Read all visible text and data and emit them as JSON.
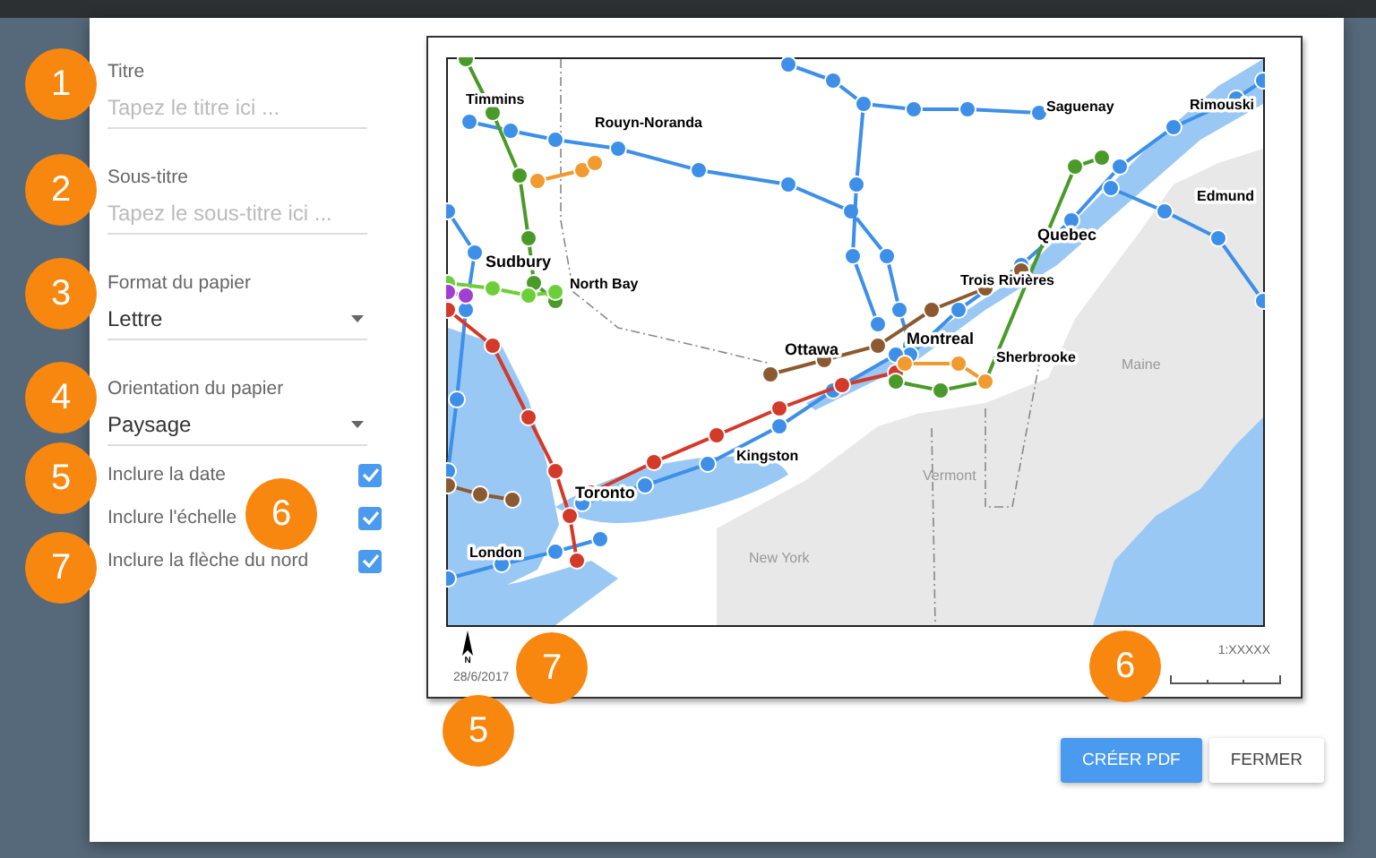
{
  "form": {
    "fields": [
      {
        "kind": "text",
        "label": "Titre",
        "placeholder": "Tapez le titre ici ..."
      },
      {
        "kind": "text",
        "label": "Sous-titre",
        "placeholder": "Tapez le sous-titre ici ..."
      },
      {
        "kind": "select",
        "label": "Format du papier",
        "value": "Lettre"
      },
      {
        "kind": "select",
        "label": "Orientation du papier",
        "value": "Paysage"
      }
    ],
    "options": [
      {
        "label": "Inclure la date",
        "checked": true
      },
      {
        "label": "Inclure l'échelle",
        "checked": true
      },
      {
        "label": "Inclure la flèche du nord",
        "checked": true
      }
    ]
  },
  "preview": {
    "map_labels": [
      {
        "text": "Timmins",
        "kind": "city"
      },
      {
        "text": "Rouyn-Noranda",
        "kind": "city"
      },
      {
        "text": "Saguenay",
        "kind": "city"
      },
      {
        "text": "Rimouski",
        "kind": "city"
      },
      {
        "text": "Edmund",
        "kind": "city"
      },
      {
        "text": "Quebec",
        "kind": "major"
      },
      {
        "text": "Sudbury",
        "kind": "major"
      },
      {
        "text": "North Bay",
        "kind": "city"
      },
      {
        "text": "Trois Rivières",
        "kind": "city"
      },
      {
        "text": "Montreal",
        "kind": "major"
      },
      {
        "text": "Ottawa",
        "kind": "major"
      },
      {
        "text": "Sherbrooke",
        "kind": "city"
      },
      {
        "text": "Maine",
        "kind": "region"
      },
      {
        "text": "Kingston",
        "kind": "city"
      },
      {
        "text": "Vermont",
        "kind": "region"
      },
      {
        "text": "Toronto",
        "kind": "major"
      },
      {
        "text": "New York",
        "kind": "region"
      },
      {
        "text": "London",
        "kind": "city"
      }
    ],
    "north": "N",
    "date": "28/6/2017",
    "scale": "1:XXXXX"
  },
  "buttons": [
    {
      "label": "CRÉER PDF",
      "kind": "primary"
    },
    {
      "label": "FERMER",
      "kind": "secondary"
    }
  ],
  "callouts": [
    {
      "number": "1"
    },
    {
      "number": "2"
    },
    {
      "number": "3"
    },
    {
      "number": "4"
    },
    {
      "number": "5"
    },
    {
      "number": "6"
    },
    {
      "number": "7"
    },
    {
      "number": "7"
    },
    {
      "number": "6"
    },
    {
      "number": "5"
    }
  ]
}
